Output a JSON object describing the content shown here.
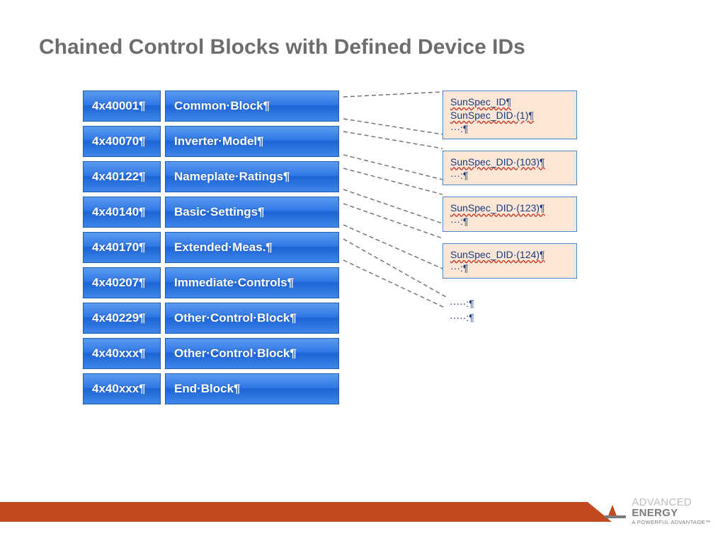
{
  "title": "Chained Control Blocks with Defined Device IDs",
  "rows": [
    {
      "addr": "4x40001¶",
      "name": "Common·Block¶"
    },
    {
      "addr": "4x40070¶",
      "name": "Inverter·Model¶"
    },
    {
      "addr": "4x40122¶",
      "name": "Nameplate·Ratings¶"
    },
    {
      "addr": "4x40140¶",
      "name": "Basic·Settings¶"
    },
    {
      "addr": "4x40170¶",
      "name": "Extended·Meas.¶"
    },
    {
      "addr": "4x40207¶",
      "name": "Immediate·Controls¶"
    },
    {
      "addr": "4x40229¶",
      "name": "Other·Control·Block¶"
    },
    {
      "addr": "4x40xxx¶",
      "name": "Other·Control·Block¶"
    },
    {
      "addr": "4x40xxx¶",
      "name": "End·Block¶"
    }
  ],
  "details": [
    {
      "lines": [
        "SunSpec_ID¶",
        "SunSpec_DID·(1)¶",
        "···:¶"
      ]
    },
    {
      "lines": [
        "SunSpec_DID·(103)¶",
        "···:¶"
      ]
    },
    {
      "lines": [
        "SunSpec_DID·(123)¶",
        "···:¶"
      ]
    },
    {
      "lines": [
        "SunSpec_DID·(124)¶",
        "···:¶"
      ]
    }
  ],
  "ellipsis": [
    "·····:¶",
    "·····:¶"
  ],
  "logo": {
    "brand_a": "ADVANCED",
    "brand_b": "ENERGY",
    "tagline": "A POWERFUL ADVANTAGE™"
  }
}
